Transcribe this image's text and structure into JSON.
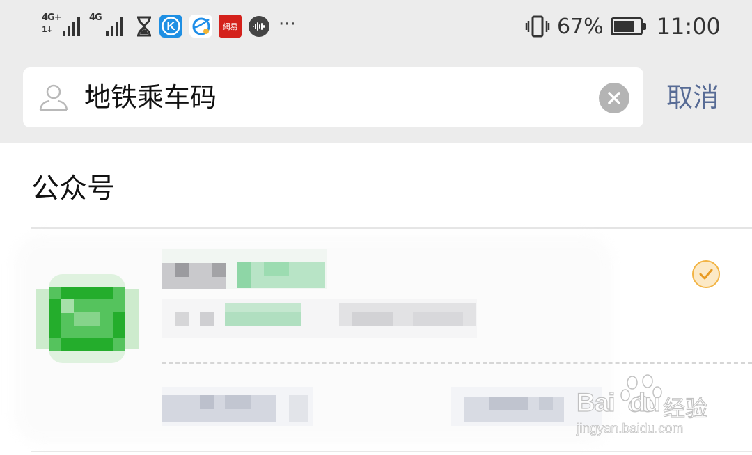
{
  "status_bar": {
    "signal1_label": "4G+",
    "signal1_sub": "1↓",
    "signal2_label": "4G",
    "app_icons": [
      "hourglass-icon",
      "k-app-icon",
      "browser-icon",
      "netease-icon",
      "podcast-icon"
    ],
    "netease_text": "網易",
    "more": "···",
    "battery_percent": "67%",
    "time": "11:00"
  },
  "search": {
    "query": "地铁乘车码",
    "cancel_label": "取消"
  },
  "results": {
    "section_title": "公众号"
  },
  "watermark": {
    "brand": "Bai",
    "brand_tail": "du",
    "cn": "经验",
    "url": "jingyan.baidu.com"
  },
  "colors": {
    "accent_link": "#576b95",
    "verified_orange": "#f2b445",
    "wechat_green": "#2aae3a"
  }
}
